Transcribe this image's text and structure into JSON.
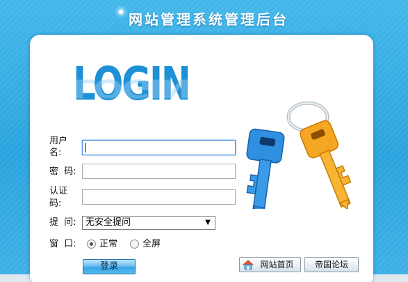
{
  "header": {
    "title": "网站管理系统管理后台"
  },
  "logo": {
    "text": "LOGIN"
  },
  "form": {
    "username_label_line1": "用户",
    "username_label_line2": "名:",
    "username_value": "",
    "password_label": "密  码:",
    "password_value": "",
    "captcha_label_line1": "认证",
    "captcha_label_line2": "码:",
    "captcha_value": "",
    "question_label": "提  问:",
    "question_selected": "无安全提问",
    "window_label": "窗  口:",
    "window_options": [
      "正常",
      "全屏"
    ],
    "window_selected": "正常",
    "login_button": "登录"
  },
  "links": {
    "home": "网站首页",
    "forum": "帝国论坛"
  },
  "colors": {
    "background": "#2aa4de",
    "logo": "#1e90d6",
    "key_blue": "#2f8fe0",
    "key_orange": "#f5a623"
  }
}
